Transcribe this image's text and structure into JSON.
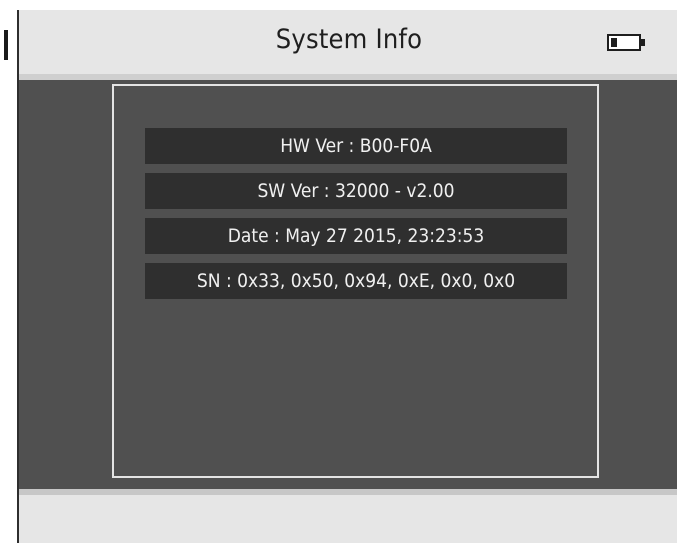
{
  "header": {
    "title": "System Info",
    "battery_icon": "battery-low-icon"
  },
  "info": {
    "rows": [
      {
        "text": "HW Ver : B00-F0A"
      },
      {
        "text": "SW Ver : 32000 - v2.00"
      },
      {
        "text": "Date : May 27 2015, 23:23:53"
      },
      {
        "text": "SN : 0x33, 0x50, 0x94, 0xE, 0x0, 0x0"
      }
    ]
  },
  "colors": {
    "background": "#505050",
    "header": "#e6e6e6",
    "row": "#2f2f2f",
    "row_text": "#f0f0f0"
  }
}
